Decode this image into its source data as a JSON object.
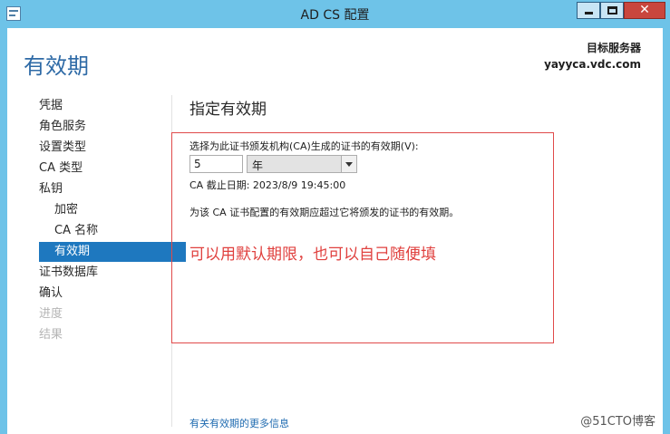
{
  "window": {
    "title": "AD CS 配置",
    "close_glyph": "✕"
  },
  "header": {
    "page_title": "有效期",
    "target_server_label": "目标服务器",
    "target_server_name": "yayyca.vdc.com"
  },
  "nav": {
    "items": [
      {
        "label": "凭据",
        "state": "normal"
      },
      {
        "label": "角色服务",
        "state": "normal"
      },
      {
        "label": "设置类型",
        "state": "normal"
      },
      {
        "label": "CA 类型",
        "state": "normal"
      },
      {
        "label": "私钥",
        "state": "normal"
      },
      {
        "label": "加密",
        "state": "normal"
      },
      {
        "label": "CA 名称",
        "state": "normal"
      },
      {
        "label": "有效期",
        "state": "selected"
      },
      {
        "label": "证书数据库",
        "state": "normal"
      },
      {
        "label": "确认",
        "state": "normal"
      },
      {
        "label": "进度",
        "state": "disabled"
      },
      {
        "label": "结果",
        "state": "disabled"
      }
    ]
  },
  "main": {
    "section_title": "指定有效期",
    "prompt": "选择为此证书颁发机构(CA)生成的证书的有效期(V):",
    "validity_value": "5",
    "validity_unit": "年",
    "expiry_text": "CA 截止日期: 2023/8/9 19:45:00",
    "warning_text": "为该 CA 证书配置的有效期应超过它将颁发的证书的有效期。",
    "annotation": "可以用默认期限，也可以自己随便填",
    "help_link": "有关有效期的更多信息"
  },
  "watermark": "@51CTO博客",
  "colors": {
    "titlebar": "#6ec3e8",
    "accent": "#1e78bf",
    "annotation_red": "#e04a4a"
  }
}
